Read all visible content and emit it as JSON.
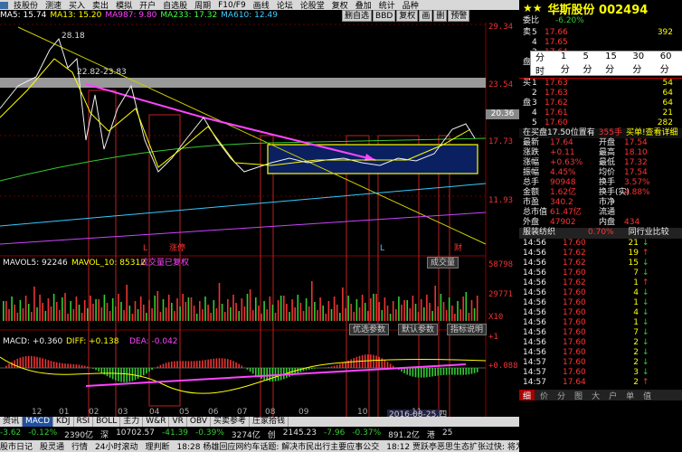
{
  "menubar": {
    "items": [
      "技股份",
      "测速",
      "买入",
      "卖出",
      "模拟",
      "开户",
      "自选股",
      "周期",
      "F10/F9",
      "画线",
      "论坛",
      "论股堂",
      "复权",
      "叠加",
      "统计",
      "品种"
    ]
  },
  "toolbar": [
    "删自选",
    "BBD",
    "复权",
    "画",
    "删",
    "预警"
  ],
  "ma_legend": [
    {
      "text": "MA5: 15.74",
      "color": "#ffffff"
    },
    {
      "text": "MA13: 15.20",
      "color": "#ffff00"
    },
    {
      "text": "MA987: 9.80",
      "color": "#ff44ff"
    },
    {
      "text": "MA233: 17.32",
      "color": "#44ff44"
    },
    {
      "text": "MA610: 12.49",
      "color": "#44ccff"
    }
  ],
  "price_axis": [
    "29.34",
    "23.54",
    "17.73",
    "11.93"
  ],
  "current_price_box": "20.36",
  "annotations": {
    "high": "28.18",
    "range": "22.82-23.83",
    "low_marker": "L",
    "zhang_marker": "涨停",
    "L2": "L",
    "cai_marker": "财"
  },
  "vol_panel": {
    "legend": [
      "MAVOL5: 92246",
      "MAVOL_10: 85312",
      "成交量已复权"
    ],
    "button": "成交量",
    "axis": [
      "58798",
      "29771",
      "X10"
    ],
    "buttons": [
      "优选参数",
      "默认参数",
      "指标说明"
    ]
  },
  "macd_panel": {
    "legend": [
      "MACD: +0.360",
      "DIFF: +0.138",
      "DEA: -0.042"
    ],
    "axis": [
      "+1",
      "+0.088"
    ],
    "date_label": "2016-08-25,四"
  },
  "x_labels": [
    "12",
    "01",
    "02",
    "03",
    "04",
    "05",
    "06",
    "07",
    "08",
    "09",
    "10",
    "11"
  ],
  "bottom_tabs": [
    "资讯",
    "MACD",
    "KDJ",
    "RSI",
    "BOLL",
    "主力",
    "W&R",
    "VR",
    "OBV",
    "买卖参考",
    "庄家拾钱"
  ],
  "status1": [
    "-3.62",
    "-0.12%",
    "2390亿",
    "深",
    "10702.57",
    "-41.39",
    "-0.39%",
    "3274亿",
    "创",
    "2145.23",
    "-7.96",
    "-0.37%",
    "891.2亿",
    "港",
    "25"
  ],
  "status2": [
    "股市日记",
    "股灵通",
    "行情",
    "24小时滚动",
    "理判断",
    "18:28 杨雄回应网约车话题: 解决市民出行主要应事公交",
    "18:12 贾跃亭恶思生态扩张过快: 将为此承担责任"
  ],
  "right_panel": {
    "title": "华斯股份 002494",
    "weibi_label": "委比",
    "weibi_value": "-6.20%",
    "timeframes": [
      "分时",
      "1分",
      "5分",
      "15分",
      "30分",
      "60分"
    ],
    "sell_rows": [
      {
        "label": "卖",
        "lvl": "5",
        "price": "17.66",
        "vol": "392"
      },
      {
        "label": "",
        "lvl": "4",
        "price": "17.65",
        "vol": ""
      },
      {
        "label": "",
        "lvl": "3",
        "price": "17.64",
        "vol": ""
      },
      {
        "label": "盘",
        "lvl": "2",
        "price": "17.66",
        "vol": "49"
      },
      {
        "label": "",
        "lvl": "1",
        "price": "17.64",
        "vol": "30"
      }
    ],
    "buy_rows": [
      {
        "label": "买",
        "lvl": "1",
        "price": "17.63",
        "vol": "54"
      },
      {
        "label": "",
        "lvl": "2",
        "price": "17.63",
        "vol": "64"
      },
      {
        "label": "盘",
        "lvl": "3",
        "price": "17.62",
        "vol": "64"
      },
      {
        "label": "",
        "lvl": "4",
        "price": "17.61",
        "vol": "21"
      },
      {
        "label": "",
        "lvl": "5",
        "price": "17.60",
        "vol": "282"
      }
    ],
    "tip": "在买盘17.50位置有",
    "tip2": "355手",
    "tip3": "买单!查看详细",
    "stats": [
      [
        "最新",
        "17.64",
        "开盘",
        "17.54"
      ],
      [
        "涨跌",
        "+0.11",
        "最高",
        "18.10"
      ],
      [
        "涨幅",
        "+0.63%",
        "最低",
        "17.32"
      ],
      [
        "振幅",
        "4.45%",
        "均价",
        "17.54"
      ],
      [
        "总手",
        "90948",
        "换手",
        "3.57%"
      ],
      [
        "金额",
        "1.62亿",
        "换手(实)",
        "4.88%"
      ],
      [
        "市盈",
        "340.2",
        "市净",
        ""
      ],
      [
        "总市值",
        "61.47亿",
        "流通",
        ""
      ],
      [
        "外盘",
        "47902",
        "内盘",
        "434"
      ]
    ],
    "sub_tabs": [
      "服装纺织",
      "0.70%",
      "同行业比较"
    ],
    "ticks": [
      {
        "time": "14:56",
        "price": "17.60",
        "vol": "21",
        "dir": "down"
      },
      {
        "time": "14:56",
        "price": "17.62",
        "vol": "19",
        "dir": "up"
      },
      {
        "time": "14:56",
        "price": "17.62",
        "vol": "15",
        "dir": "down"
      },
      {
        "time": "14:56",
        "price": "17.60",
        "vol": "7",
        "dir": "down"
      },
      {
        "time": "14:56",
        "price": "17.62",
        "vol": "1",
        "dir": "up"
      },
      {
        "time": "14:56",
        "price": "17.60",
        "vol": "4",
        "dir": "down"
      },
      {
        "time": "14:56",
        "price": "17.60",
        "vol": "1",
        "dir": "down"
      },
      {
        "time": "14:56",
        "price": "17.60",
        "vol": "4",
        "dir": "down"
      },
      {
        "time": "14:56",
        "price": "17.60",
        "vol": "1",
        "dir": "down"
      },
      {
        "time": "14:56",
        "price": "17.60",
        "vol": "7",
        "dir": "down"
      },
      {
        "time": "14:56",
        "price": "17.60",
        "vol": "2",
        "dir": "down"
      },
      {
        "time": "14:56",
        "price": "17.60",
        "vol": "2",
        "dir": "down"
      },
      {
        "time": "14:57",
        "price": "17.60",
        "vol": "2",
        "dir": "down"
      },
      {
        "time": "14:57",
        "price": "17.60",
        "vol": "3",
        "dir": "down"
      },
      {
        "time": "14:57",
        "price": "17.64",
        "vol": "2",
        "dir": "up"
      }
    ],
    "bottom_tabs": [
      "细",
      "价",
      "分",
      "图",
      "大",
      "户",
      "单",
      "值"
    ]
  }
}
